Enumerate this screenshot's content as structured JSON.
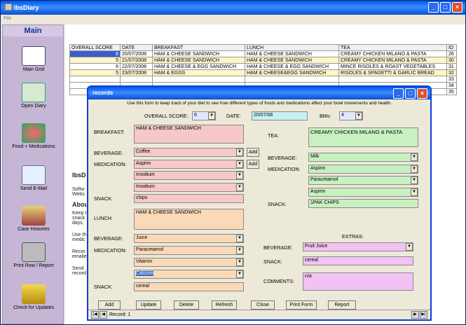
{
  "app": {
    "title": "IbsDiary",
    "menu": "File"
  },
  "sidebar": {
    "header": "Main",
    "items": [
      {
        "label": "Main Grid"
      },
      {
        "label": "Open Diary"
      },
      {
        "label": "Food + Medications"
      },
      {
        "label": "Send E-Mail"
      },
      {
        "label": "Case Histories"
      },
      {
        "label": "Print Row / Report"
      },
      {
        "label": "Check for Updates"
      }
    ]
  },
  "grid": {
    "headers": [
      "OVERALL SCORE",
      "DATE",
      "BREAKFAST",
      "LUNCH",
      "TEA",
      "ID"
    ],
    "rows": [
      [
        "6",
        "20/07/2008",
        "HAM & CHEESE SANDWICH",
        "HAM & CHEESE SANDWICH",
        "CREAMY CHICKEN MILANO & PASTA",
        "26"
      ],
      [
        "5",
        "21/07/2008",
        "HAM & CHEESE SANDWICH",
        "HAM & CHEESE SANDWICH",
        "CREAMY CHICKEN MILANO & PASTA",
        "30"
      ],
      [
        "6",
        "22/07/2008",
        "HAM & CHEESE & EGG SANDWICH",
        "HAM & CHEESE & EGG SANDWICH",
        "MINCE RISOLES & ROAST VEGETABLES",
        "31"
      ],
      [
        "5",
        "23/07/2008",
        "HAM & EGGS",
        "HAM & CHEESE&EGG SANDWICH",
        "RISOLES & SPAGETTI & GARLIC BREAD",
        "32"
      ],
      [
        "",
        "",
        "",
        "",
        "",
        "33"
      ],
      [
        "",
        "",
        "",
        "",
        "",
        "34"
      ],
      [
        "",
        "",
        "",
        "",
        "",
        "35"
      ]
    ]
  },
  "about": {
    "heading": "IbsD",
    "text1": "Softw",
    "text2": "Webs",
    "heading2": "Abou",
    "p1": "Keep t",
    "p2": "snack",
    "p3": "days,",
    "p4": "Use th",
    "p5": "medic",
    "p6": "Recor",
    "p7": "emaile",
    "p8": "Send",
    "p9": "record"
  },
  "records": {
    "title": "records",
    "info": "Use this form to keep track of your diet to see how different types of foods and medications affect your bowl movements and health.",
    "overall_label": "OVERALL SCORE:",
    "overall": "6",
    "date_label": "DATE:",
    "date": "20/07/08",
    "bms_label": "BMs:",
    "bms": "4",
    "breakfast_label": "BREAKFAST:",
    "breakfast": "HAM & CHEESE SANDWICH",
    "beverage_label": "BEVERAGE:",
    "b_beverage": "Coffee",
    "medication_label": "MEDICATION:",
    "b_med1": "Aspirin",
    "b_med2": "Imodium",
    "b_med3": "Imodium",
    "snack_label": "SNACK:",
    "b_snack": "chips",
    "add": "Add",
    "lunch_label": "LUNCH:",
    "lunch": "HAM & CHEESE SANDWICH",
    "l_beverage": "Juice",
    "l_med1": "Paracetamol",
    "l_med2": "Vitamin",
    "l_med3": "Calcium",
    "l_snack": "cereal",
    "tea_label": "TEA:",
    "tea": "CREAMY CHICKEN MILANO & PASTA",
    "t_beverage": "Milk",
    "t_med1": "Aspirin",
    "t_med2": "Paracetamol",
    "t_med3": "Aspirin",
    "t_snack": "1PAK CHIPS",
    "extras_label": "EXTRAS:",
    "e_beverage": "Fruit Juice",
    "e_snack": "cereal",
    "comments_label": "COMMENTS:",
    "comments": "n/a",
    "buttons": [
      "Add",
      "Update",
      "Delete",
      "Refresh",
      "Close",
      "Print Form",
      "Report"
    ],
    "record_nav": "Record: 1"
  }
}
